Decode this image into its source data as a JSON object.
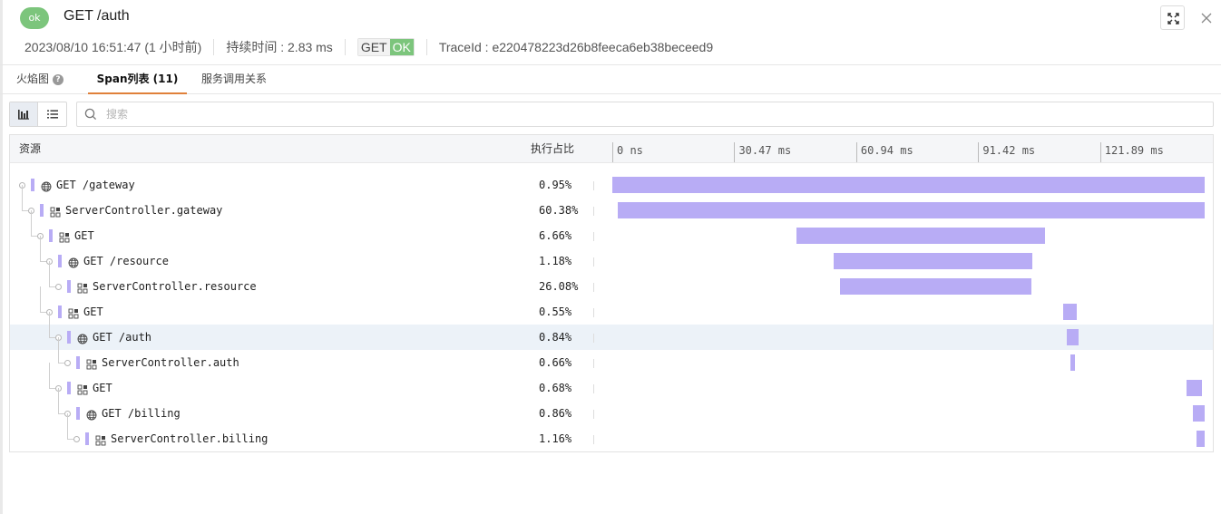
{
  "header": {
    "status": "ok",
    "title": "GET /auth",
    "datetime": "2023/08/10 16:51:47 (1 小时前)",
    "duration": "持续时间 : 2.83 ms",
    "method": "GET",
    "code": "OK",
    "trace_id": "TraceId : e220478223d26b8feeca6eb38beceed9"
  },
  "tabs": [
    {
      "label": "火焰图"
    },
    {
      "label": "Span列表 (11)"
    },
    {
      "label": "服务调用关系"
    }
  ],
  "search": {
    "placeholder": "搜索"
  },
  "table": {
    "col_resource": "资源",
    "col_percent": "执行占比",
    "axis": {
      "max_ms": 148,
      "ticks": [
        {
          "label": "0 ns",
          "value": 0
        },
        {
          "label": "30.47 ms",
          "value": 30.47
        },
        {
          "label": "60.94 ms",
          "value": 60.94
        },
        {
          "label": "91.42 ms",
          "value": 91.42
        },
        {
          "label": "121.89 ms",
          "value": 121.89
        }
      ]
    },
    "rows": [
      {
        "depth": 0,
        "icon": "globe-icon",
        "name": "GET /gateway",
        "percent": "0.95%",
        "start_ms": 0.0,
        "end_ms": 148.0
      },
      {
        "depth": 1,
        "icon": "component-icon",
        "name": "ServerController.gateway",
        "percent": "60.38%",
        "start_ms": 1.4,
        "end_ms": 148.0
      },
      {
        "depth": 2,
        "icon": "component-icon",
        "name": "GET",
        "percent": "6.66%",
        "start_ms": 46.1,
        "end_ms": 108.2
      },
      {
        "depth": 3,
        "icon": "globe-icon",
        "name": "GET /resource",
        "percent": "1.18%",
        "start_ms": 55.2,
        "end_ms": 105.0
      },
      {
        "depth": 4,
        "icon": "component-icon",
        "name": "ServerController.resource",
        "percent": "26.08%",
        "start_ms": 57.0,
        "end_ms": 104.6
      },
      {
        "depth": 3,
        "icon": "component-icon",
        "name": "GET",
        "percent": "0.55%",
        "start_ms": 112.7,
        "end_ms": 116.1
      },
      {
        "depth": 4,
        "icon": "globe-icon",
        "name": "GET /auth",
        "percent": "0.84%",
        "start_ms": 113.6,
        "end_ms": 116.6,
        "selected": true
      },
      {
        "depth": 5,
        "icon": "component-icon",
        "name": "ServerController.auth",
        "percent": "0.66%",
        "start_ms": 114.5,
        "end_ms": 115.6
      },
      {
        "depth": 4,
        "icon": "component-icon",
        "name": "GET",
        "percent": "0.68%",
        "start_ms": 143.5,
        "end_ms": 147.3
      },
      {
        "depth": 5,
        "icon": "globe-icon",
        "name": "GET /billing",
        "percent": "0.86%",
        "start_ms": 145.1,
        "end_ms": 148.0
      },
      {
        "depth": 6,
        "icon": "component-icon",
        "name": "ServerController.billing",
        "percent": "1.16%",
        "start_ms": 146.0,
        "end_ms": 148.0
      }
    ]
  },
  "colors": {
    "bar": "#b8acf5",
    "ok": "#7cc57c",
    "active_tab": "#e0803a",
    "selected_row": "#ecf2f8"
  }
}
